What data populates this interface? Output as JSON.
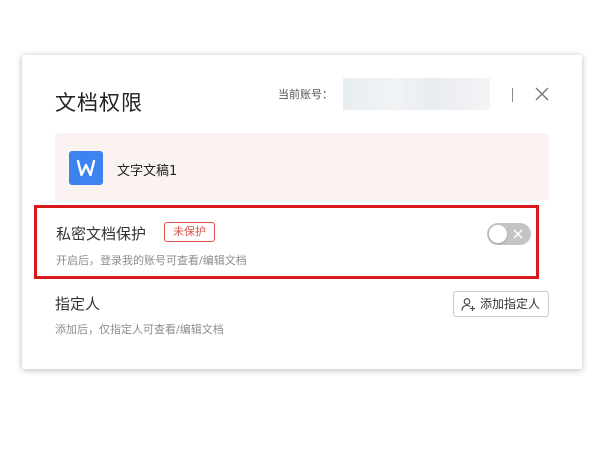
{
  "dialog": {
    "title": "文档权限",
    "account_label": "当前账号：",
    "account_value": ""
  },
  "file": {
    "icon_letter": "W",
    "name": "文字文稿1",
    "icon_color": "#3d83f0"
  },
  "private_protection": {
    "title": "私密文档保护",
    "badge": "未保护",
    "description": "开启后，登录我的账号可查看/编辑文档",
    "enabled": false,
    "highlight_color": "#d7191c"
  },
  "designee": {
    "title": "指定人",
    "description": "添加后，仅指定人可查看/编辑文档",
    "add_button_label": "添加指定人"
  },
  "colors": {
    "badge": "#e0524e",
    "toggle_off": "#c4c4c4"
  }
}
